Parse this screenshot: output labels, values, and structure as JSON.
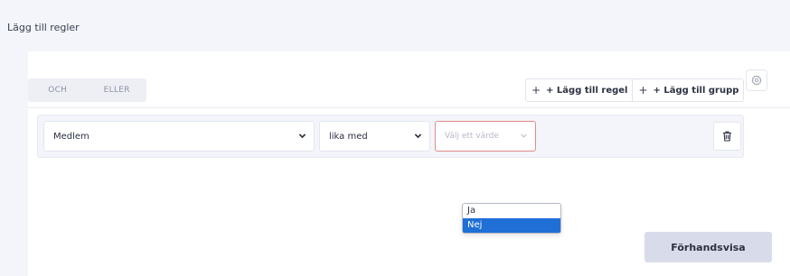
{
  "page": {
    "title": "Lägg till regler"
  },
  "icons": {
    "settings": "gear-icon",
    "add": "plus-icon",
    "chevron": "chevron-down-icon",
    "delete": "trash-icon"
  },
  "logic_tabs": [
    {
      "label": "OCH"
    },
    {
      "label": "ELLER"
    }
  ],
  "actions": {
    "add_rule_plus": "+",
    "add_rule_label": "+ Lägg till regel",
    "add_group_plus": "+",
    "add_group_label": "+ Lägg till grupp",
    "preview_label": "Förhandsvisa"
  },
  "rule": {
    "field_value": "Medlem",
    "operator_value": "lika med",
    "value_placeholder": "Välj ett värde"
  },
  "value_dropdown": {
    "options": [
      {
        "label": "Ja"
      },
      {
        "label": "Nej"
      }
    ],
    "highlighted": "Nej"
  },
  "colors": {
    "page_background": "#f3f5fa",
    "highlight": "#1f6fd6",
    "error_border": "#e38a8a",
    "preview_button": "#d8dcea"
  }
}
